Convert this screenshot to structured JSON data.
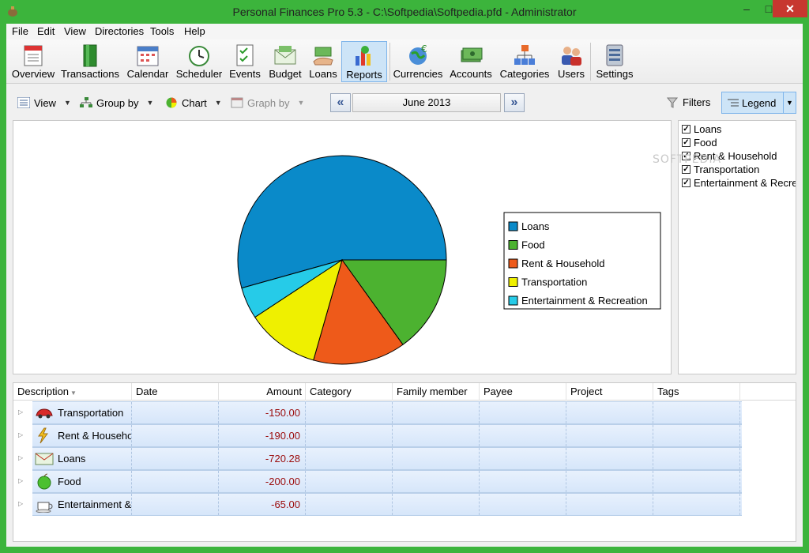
{
  "window": {
    "title": "Personal Finances Pro 5.3 - C:\\Softpedia\\Softpedia.pfd - Administrator",
    "min_symbol": "–",
    "max_symbol": "□",
    "close_symbol": "✕"
  },
  "menu": [
    "File",
    "Edit",
    "View",
    "Directories",
    "Tools",
    "Help"
  ],
  "toolbar": [
    {
      "label": "Overview",
      "icon": "overview-icon"
    },
    {
      "label": "Transactions",
      "icon": "transactions-book-icon"
    },
    {
      "label": "Calendar",
      "icon": "calendar-icon"
    },
    {
      "label": "Scheduler",
      "icon": "scheduler-clock-icon"
    },
    {
      "label": "Events",
      "icon": "events-checklist-icon"
    },
    {
      "label": "Budget",
      "icon": "budget-envelope-icon"
    },
    {
      "label": "Loans",
      "icon": "loans-hand-money-icon"
    },
    {
      "label": "Reports",
      "icon": "reports-chart-icon",
      "active": true
    },
    {
      "label": "Currencies",
      "icon": "currencies-globe-icon"
    },
    {
      "label": "Accounts",
      "icon": "accounts-cash-icon"
    },
    {
      "label": "Categories",
      "icon": "categories-tree-icon"
    },
    {
      "label": "Users",
      "icon": "users-icon"
    },
    {
      "label": "Settings",
      "icon": "settings-icon"
    }
  ],
  "subtoolbar": {
    "view": "View",
    "group_by": "Group by",
    "chart": "Chart",
    "graph_by": "Graph by",
    "period": "June 2013",
    "filters": "Filters",
    "legend": "Legend"
  },
  "legend_panel": [
    "Loans",
    "Food",
    "Rent & Household",
    "Transportation",
    "Entertainment & Recreation"
  ],
  "watermark": "SOFTPEDIA",
  "chart_data": {
    "type": "pie",
    "labels": [
      "Loans",
      "Food",
      "Rent & Household",
      "Transportation",
      "Entertainment & Recreation"
    ],
    "values": [
      720.28,
      200.0,
      190.0,
      150.0,
      65.0
    ],
    "colors": [
      "#0a8ac9",
      "#4cb230",
      "#ee5a1a",
      "#eff000",
      "#26cbe8"
    ],
    "legend_placement": "right"
  },
  "grid": {
    "columns": [
      "Description",
      "Date",
      "Amount",
      "Category",
      "Family member",
      "Payee",
      "Project",
      "Tags"
    ],
    "rows": [
      {
        "description": "Transportation",
        "date": "",
        "amount": "-150.00",
        "icon": "car-icon"
      },
      {
        "description": "Rent & Household",
        "date": "",
        "amount": "-190.00",
        "icon": "lightning-icon"
      },
      {
        "description": "Loans",
        "date": "",
        "amount": "-720.28",
        "icon": "envelope-money-icon"
      },
      {
        "description": "Food",
        "date": "",
        "amount": "-200.00",
        "icon": "apple-icon"
      },
      {
        "description": "Entertainment & Recreation",
        "date": "",
        "amount": "-65.00",
        "icon": "coffee-cup-icon"
      }
    ]
  }
}
